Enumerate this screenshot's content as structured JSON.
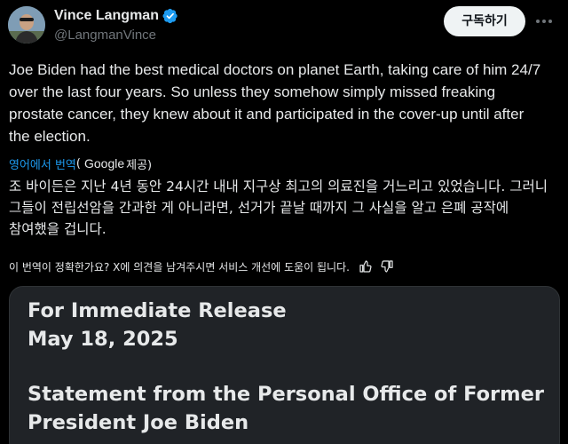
{
  "author": {
    "display_name": "Vince Langman",
    "username": "@LangmanVince",
    "verified_icon": "verified-badge-icon",
    "avatar_icon": "avatar-photo"
  },
  "actions": {
    "subscribe_label": "구독하기",
    "more_icon": "more-options-icon"
  },
  "tweet": {
    "text": "Joe Biden had the best medical doctors on planet Earth, taking care of him 24/7 over the last four years. So unless they somehow simply missed freaking prostate cancer, they knew about it and participated in the cover-up until after the election."
  },
  "translation": {
    "link_label": "영어에서 번역",
    "paren_open": "(",
    "provider": "Google",
    "provider_suffix": "제공)",
    "text": "조 바이든은 지난 4년 동안 24시간 내내 지구상 최고의 의료진을 거느리고 있었습니다. 그러니 그들이 전립선암을 간과한 게 아니라면, 선거가 끝날 때까지 그 사실을 알고 은폐 공작에 참여했을 겁니다.",
    "feedback_prompt": "이 번역이 정확한가요? X에 의견을 남겨주시면 서비스 개선에 도움이 됩니다.",
    "thumbs_up_icon": "thumbs-up-icon",
    "thumbs_down_icon": "thumbs-down-icon"
  },
  "media": {
    "line1": "For Immediate Release",
    "line2": "May 18, 2025",
    "line3": "Statement from the Personal Office of Former",
    "line4": "President Joe Biden"
  },
  "colors": {
    "background": "#000000",
    "text": "#e7e9ea",
    "secondary_text": "#71767b",
    "link": "#1d9bf0",
    "button_bg": "#eff3f4",
    "media_bg": "#202327"
  }
}
